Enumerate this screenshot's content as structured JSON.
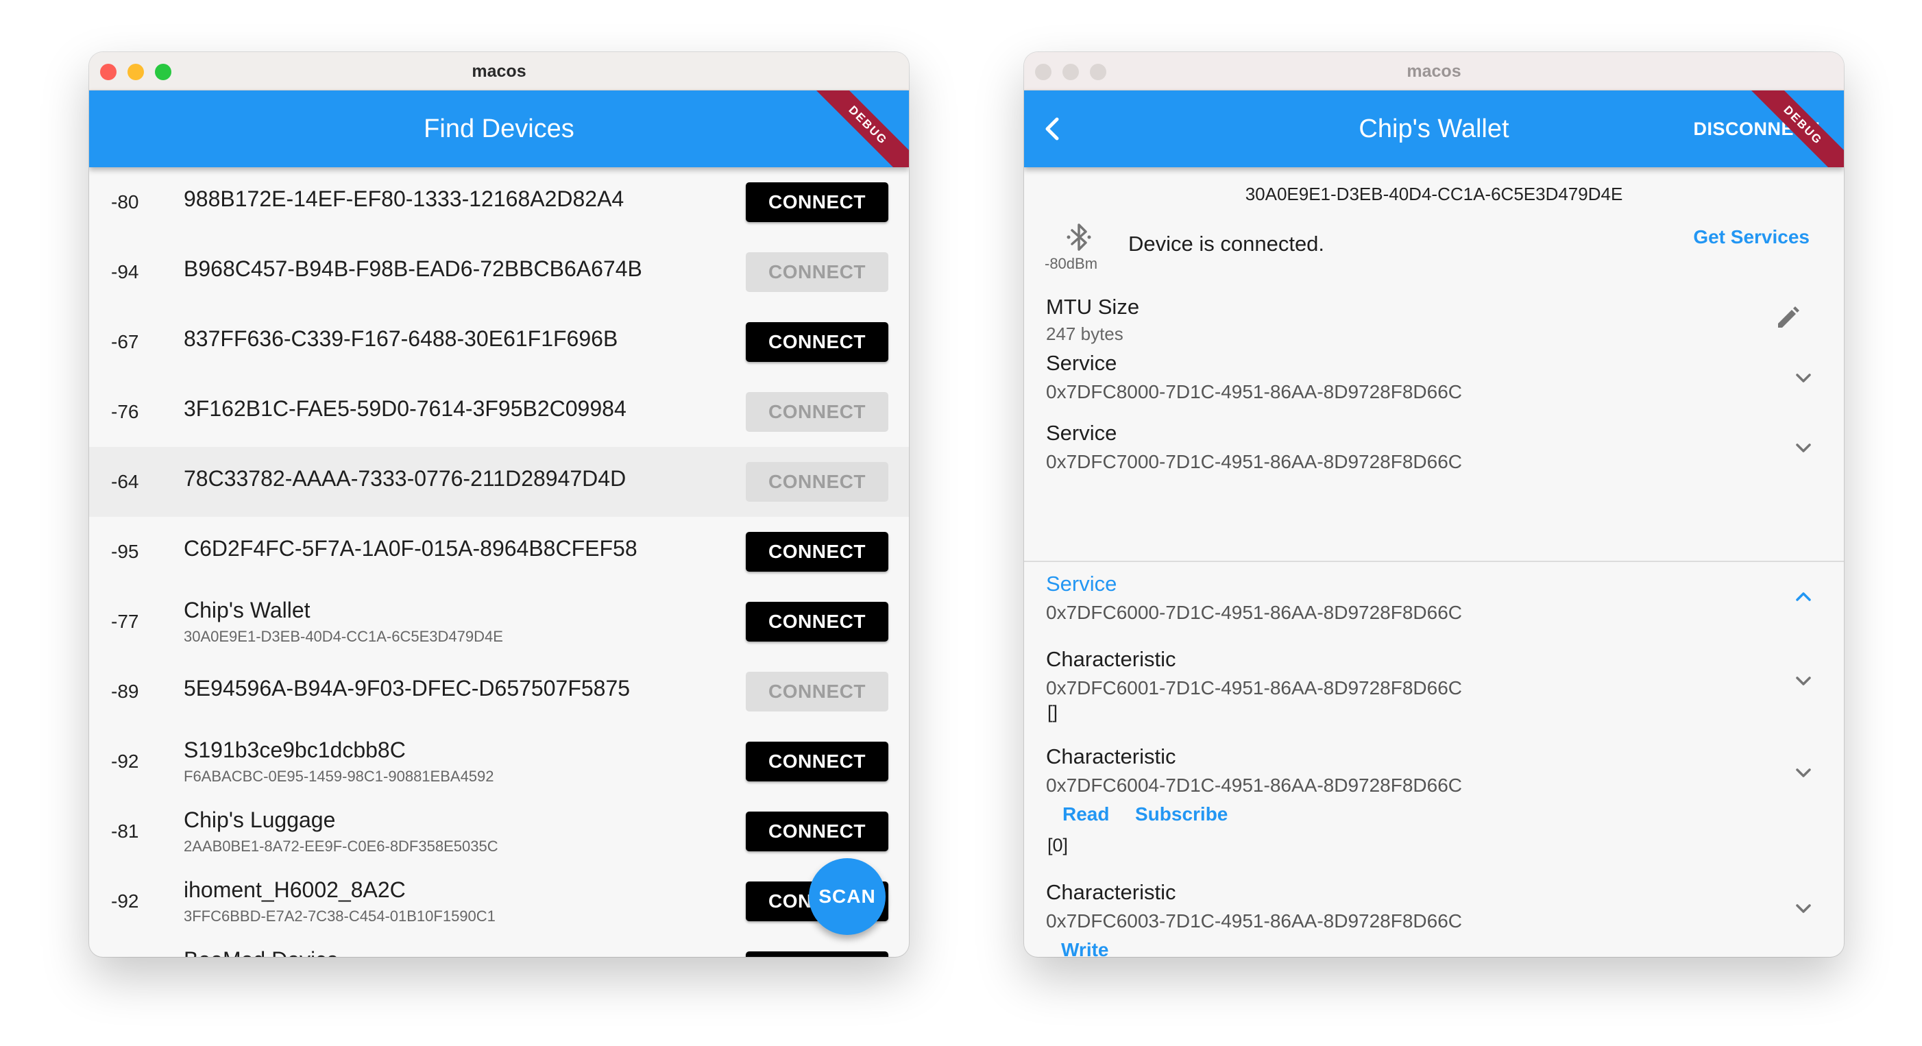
{
  "left_window": {
    "title": "macos",
    "appbar_title": "Find Devices",
    "debug_label": "DEBUG",
    "scan_label": "SCAN",
    "devices": [
      {
        "rssi": "-80",
        "name": "988B172E-14EF-EF80-1333-12168A2D82A4",
        "id": "",
        "button": "CONNECT",
        "enabled": true
      },
      {
        "rssi": "-94",
        "name": "B968C457-B94B-F98B-EAD6-72BBCB6A674B",
        "id": "",
        "button": "CONNECT",
        "enabled": false
      },
      {
        "rssi": "-67",
        "name": "837FF636-C339-F167-6488-30E61F1F696B",
        "id": "",
        "button": "CONNECT",
        "enabled": true
      },
      {
        "rssi": "-76",
        "name": "3F162B1C-FAE5-59D0-7614-3F95B2C09984",
        "id": "",
        "button": "CONNECT",
        "enabled": false
      },
      {
        "rssi": "-64",
        "name": "78C33782-AAAA-7333-0776-211D28947D4D",
        "id": "",
        "button": "CONNECT",
        "enabled": false,
        "highlight": true
      },
      {
        "rssi": "-95",
        "name": "C6D2F4FC-5F7A-1A0F-015A-8964B8CFEF58",
        "id": "",
        "button": "CONNECT",
        "enabled": true
      },
      {
        "rssi": "-77",
        "name": "Chip's Wallet",
        "id": "30A0E9E1-D3EB-40D4-CC1A-6C5E3D479D4E",
        "button": "CONNECT",
        "enabled": true
      },
      {
        "rssi": "-89",
        "name": "5E94596A-B94A-9F03-DFEC-D657507F5875",
        "id": "",
        "button": "CONNECT",
        "enabled": false
      },
      {
        "rssi": "-92",
        "name": "S191b3ce9bc1dcbb8C",
        "id": "F6ABACBC-0E95-1459-98C1-90881EBA4592",
        "button": "CONNECT",
        "enabled": true
      },
      {
        "rssi": "-81",
        "name": "Chip's Luggage",
        "id": "2AAB0BE1-8A72-EE9F-C0E6-8DF358E5035C",
        "button": "CONNECT",
        "enabled": true
      },
      {
        "rssi": "-92",
        "name": "ihoment_H6002_8A2C",
        "id": "3FFC6BBD-E7A2-7C38-C454-01B10F1590C1",
        "button": "CONNECT",
        "enabled": true
      },
      {
        "rssi": "",
        "name": "BeeMed Device",
        "id": "",
        "button": "",
        "enabled": true
      }
    ]
  },
  "right_window": {
    "title": "macos",
    "appbar_title": "Chip's Wallet",
    "disconnect_label": "DISCONNECT",
    "debug_label": "DEBUG",
    "device_uuid": "30A0E9E1-D3EB-40D4-CC1A-6C5E3D479D4E",
    "rssi_dbm": "-80dBm",
    "status": "Device is connected.",
    "get_services_label": "Get Services",
    "mtu_title": "MTU Size",
    "mtu_value": "247 bytes",
    "services": [
      {
        "title": "Service",
        "uuid": "0x7DFC8000-7D1C-4951-86AA-8D9728F8D66C",
        "expanded": false
      },
      {
        "title": "Service",
        "uuid": "0x7DFC7000-7D1C-4951-86AA-8D9728F8D66C",
        "expanded": false
      },
      {
        "title": "Service",
        "uuid": "0x7DFC6000-7D1C-4951-86AA-8D9728F8D66C",
        "expanded": true
      }
    ],
    "characteristics": [
      {
        "title": "Characteristic",
        "uuid": "0x7DFC6001-7D1C-4951-86AA-8D9728F8D66C",
        "value": "[]",
        "actions": []
      },
      {
        "title": "Characteristic",
        "uuid": "0x7DFC6004-7D1C-4951-86AA-8D9728F8D66C",
        "value": "[0]",
        "actions": [
          "Read",
          "Subscribe"
        ]
      },
      {
        "title": "Characteristic",
        "uuid": "0x7DFC6003-7D1C-4951-86AA-8D9728F8D66C",
        "value": "[]",
        "actions": [
          "Write"
        ]
      }
    ]
  },
  "colors": {
    "accent": "#2296f3",
    "debug_banner": "#a41e3a",
    "button_enabled": "#000000",
    "button_disabled": "#dedede"
  }
}
